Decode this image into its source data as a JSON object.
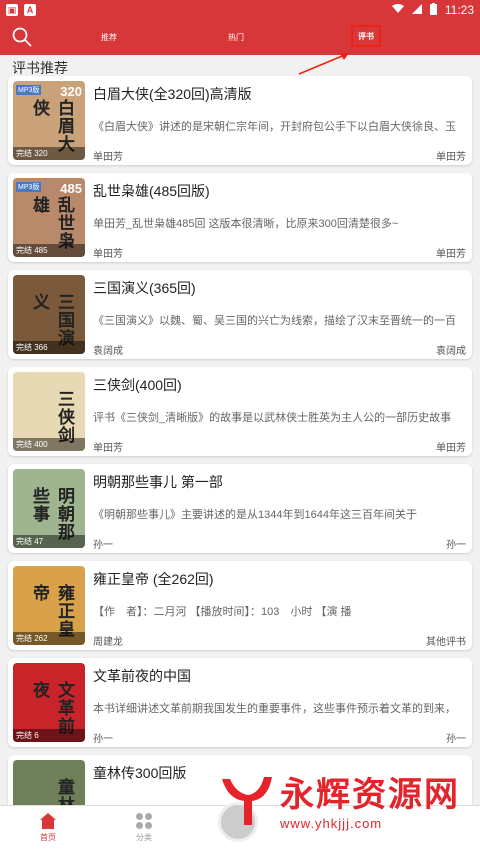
{
  "colors": {
    "brand": "#d8373a",
    "accent_box": "#ee2211",
    "card_bg": "#ffffff"
  },
  "status": {
    "time": "11:23"
  },
  "tabs": {
    "recommend": "推荐",
    "hot": "热门",
    "pingshu": "评书"
  },
  "section_title": "评书推荐",
  "books": [
    {
      "title": "白眉大侠(全320回)高清版",
      "desc": "《白眉大侠》讲述的是宋朝仁宗年间，开封府包公手下以白眉大侠徐良、玉",
      "author": "单田芳",
      "category": "单田芳",
      "badge": "完结 320",
      "cover_num": "320",
      "cover_mp3": "MP3版",
      "cover_title": "白眉大侠",
      "cover_bg": "#c9a27a"
    },
    {
      "title": "乱世枭雄(485回版)",
      "desc": "单田芳_乱世枭雄485回 这版本很清晰，比原来300回清楚很多~",
      "author": "单田芳",
      "category": "单田芳",
      "badge": "完结 485",
      "cover_num": "485",
      "cover_mp3": "MP3版",
      "cover_title": "乱世枭雄",
      "cover_bg": "#b9896b"
    },
    {
      "title": "三国演义(365回)",
      "desc": "《三国演义》以魏、蜀、吴三国的兴亡为线索，描绘了汉末至晋统一的一百",
      "author": "袁阔成",
      "category": "袁阔成",
      "badge": "完结 366",
      "cover_num": "",
      "cover_mp3": "",
      "cover_title": "三国演义",
      "cover_bg": "#7a5a3a"
    },
    {
      "title": "三侠剑(400回)",
      "desc": "评书《三侠剑_清晰版》的故事是以武林侠士胜英为主人公的一部历史故事",
      "author": "单田芳",
      "category": "单田芳",
      "badge": "完结 400",
      "cover_num": "",
      "cover_mp3": "",
      "cover_title": "三侠剑",
      "cover_bg": "#e7d9b3"
    },
    {
      "title": "明朝那些事儿 第一部",
      "desc": "《明朝那些事儿》主要讲述的是从1344年到1644年这三百年间关于",
      "author": "孙一",
      "category": "孙一",
      "badge": "完结 47",
      "cover_num": "",
      "cover_mp3": "",
      "cover_title": "明朝那些事",
      "cover_bg": "#9fb58f"
    },
    {
      "title": "雍正皇帝 (全262回)",
      "desc": "【作　者】：二月河 【播放时间】：103　小时 【演 播",
      "author": "周建龙",
      "category": "其他评书",
      "badge": "完结 262",
      "cover_num": "",
      "cover_mp3": "",
      "cover_title": "雍正皇帝",
      "cover_bg": "#d9a24a"
    },
    {
      "title": "文革前夜的中国",
      "desc": "本书详细讲述文革前期我国发生的重要事件，这些事件预示着文革的到来，",
      "author": "孙一",
      "category": "孙一",
      "badge": "完结 6",
      "cover_num": "",
      "cover_mp3": "",
      "cover_title": "文革前夜",
      "cover_bg": "#c8242a"
    },
    {
      "title": "童林传300回版",
      "desc": "",
      "author": "",
      "category": "",
      "badge": "",
      "cover_num": "",
      "cover_mp3": "",
      "cover_title": "童林",
      "cover_bg": "#6f7f5a"
    }
  ],
  "nav": {
    "home": "首页",
    "category": "分类"
  },
  "watermark": {
    "main": "永辉资源网",
    "url": "www.yhkjjj.com"
  }
}
